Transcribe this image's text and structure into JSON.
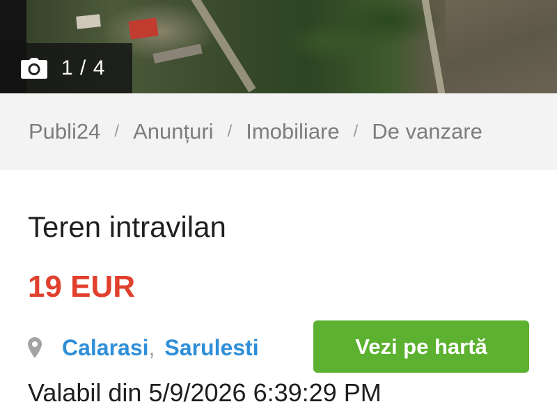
{
  "gallery": {
    "counter_text": "1 / 4",
    "icon": "camera-icon"
  },
  "breadcrumb": {
    "items": [
      "Publi24",
      "Anunțuri",
      "Imobiliare",
      "De vanzare"
    ],
    "separator": "/"
  },
  "listing": {
    "title": "Teren intravilan",
    "price": "19 EUR",
    "location": {
      "icon": "map-pin-icon",
      "county": "Calarasi",
      "separator": ",",
      "locality": "Sarulesti"
    },
    "map_button_label": "Vezi pe hartă",
    "valid_from": "Valabil din 5/9/2026 6:39:29 PM"
  },
  "colors": {
    "price": "#e0402d",
    "link": "#2f8fd8",
    "map_button": "#5cb130",
    "breadcrumb_bg": "#f3f3f3"
  }
}
